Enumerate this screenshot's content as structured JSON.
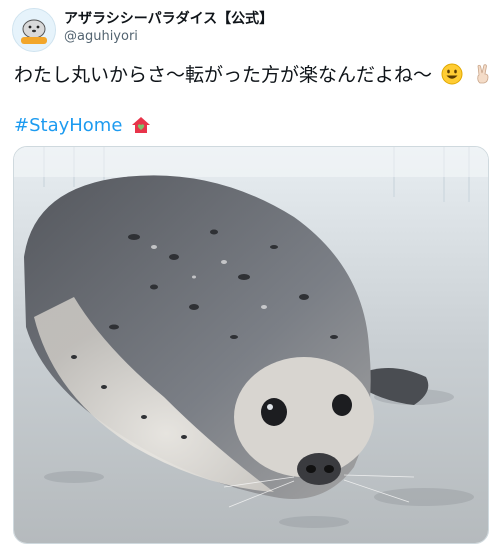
{
  "account": {
    "display_name": "アザラシシーパラダイス【公式】",
    "handle": "@aguhiyori",
    "avatar_icon": "seal-logo-icon"
  },
  "tweet": {
    "text": "わたし丸いからさ〜転がった方が楽なんだよね〜",
    "emojis": [
      "grinning-face-icon",
      "victory-hand-icon"
    ],
    "hashtag": "#StayHome"
  },
  "media": {
    "description_icon": "seal-photo",
    "colors": {
      "floor": "#c8ccd0",
      "seal_body": "#7b7f86",
      "seal_belly": "#e9e6e0"
    }
  }
}
